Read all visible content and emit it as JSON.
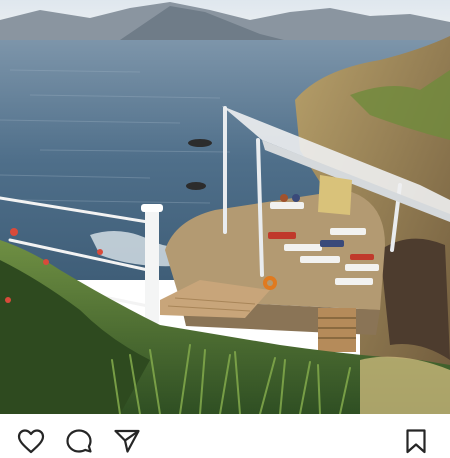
{
  "post": {
    "photo": {
      "kind": "photo",
      "description_icon": "image"
    },
    "actions": {
      "like_icon": "heart-icon",
      "comment_icon": "comment-icon",
      "share_icon": "paper-plane-icon",
      "save_icon": "bookmark-icon"
    }
  },
  "colors": {
    "sea": "#4f6f8a",
    "sky": "#e8eef2",
    "rock": "#8b6f50",
    "vegetation": "#3f6b2f",
    "icon": "#262626"
  }
}
